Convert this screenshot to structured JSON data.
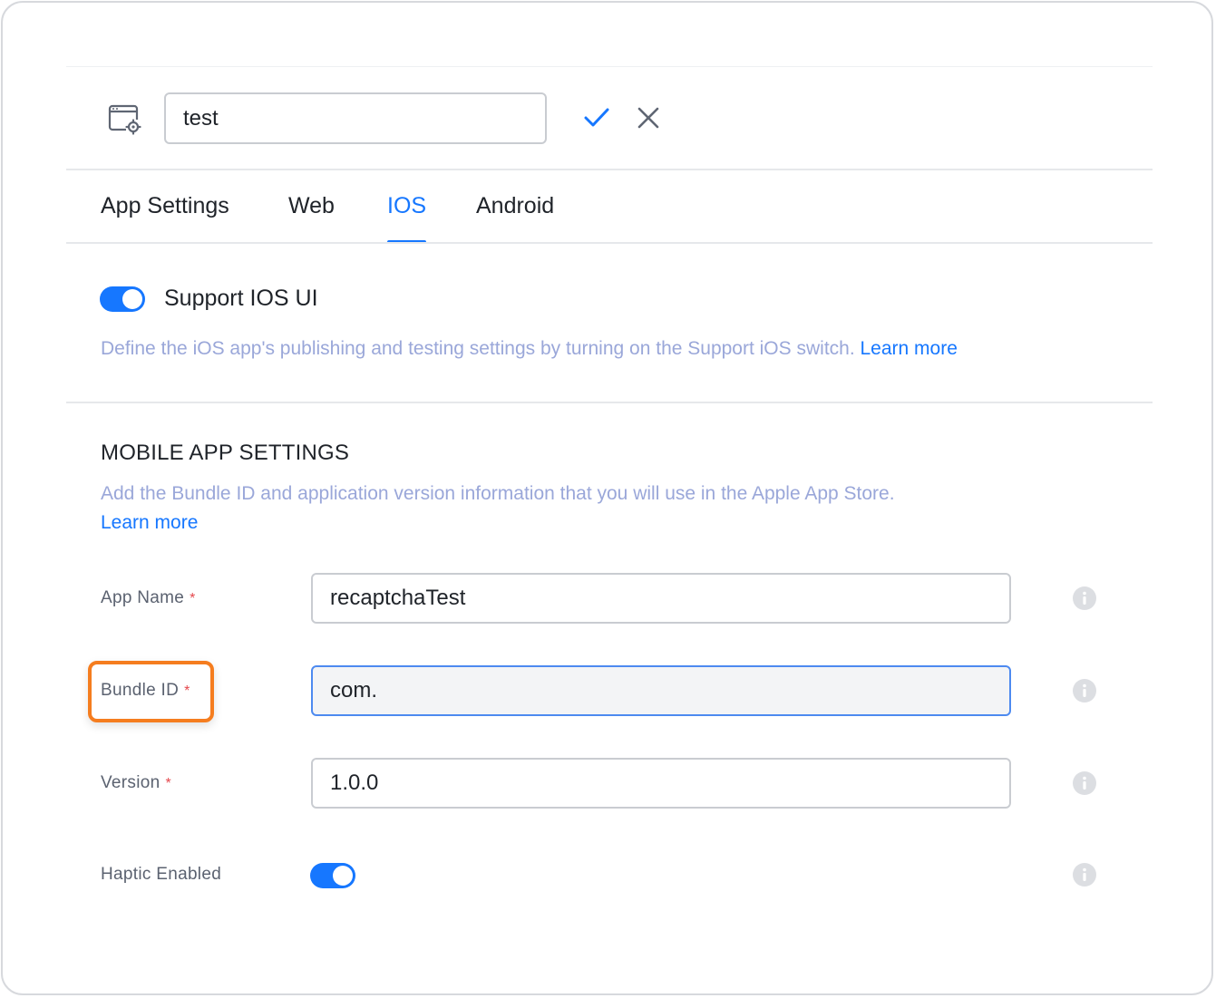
{
  "header": {
    "app_name_value": "test",
    "icons": [
      "app-settings-icon",
      "check-icon",
      "close-icon"
    ]
  },
  "tabs": [
    {
      "label": "App Settings",
      "active": false
    },
    {
      "label": "Web",
      "active": false
    },
    {
      "label": "IOS",
      "active": true
    },
    {
      "label": "Android",
      "active": false
    }
  ],
  "support": {
    "toggle_on": true,
    "label": "Support IOS UI",
    "description": "Define the iOS app's publishing and testing settings by turning on the Support iOS switch. ",
    "learn_more": "Learn more"
  },
  "mobile_settings": {
    "title": "MOBILE APP SETTINGS",
    "description": "Add the Bundle ID and application version information that you will use in the Apple App Store. ",
    "learn_more": "Learn more"
  },
  "fields": {
    "app_name": {
      "label": "App Name",
      "required": "*",
      "value": "recaptchaTest"
    },
    "bundle_id": {
      "label": "Bundle ID",
      "required": "*",
      "value": "com."
    },
    "version": {
      "label": "Version",
      "required": "*",
      "value": "1.0.0"
    },
    "haptic": {
      "label": "Haptic Enabled",
      "toggle_on": true
    }
  },
  "colors": {
    "accent": "#1677ff",
    "highlight": "#f57d1f",
    "required": "#e5484d",
    "muted_text": "#9aa7d9"
  }
}
